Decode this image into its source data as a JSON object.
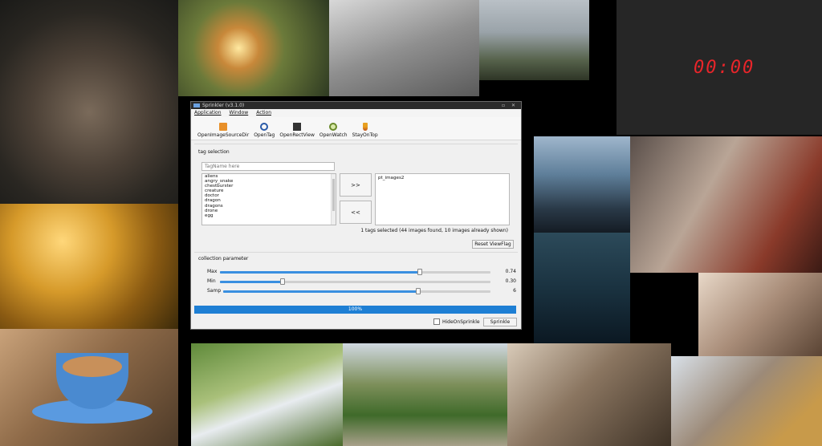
{
  "desktop": {
    "clock_text": "00:00"
  },
  "window": {
    "title": "Sprinkler (v3.1.0)",
    "menu": [
      "Application",
      "Window",
      "Action"
    ],
    "toolbar": [
      {
        "label": "OpenImageSourceDir",
        "icon": "folder-icon"
      },
      {
        "label": "OpenTag",
        "icon": "magnify-icon"
      },
      {
        "label": "OpenRectView",
        "icon": "monitor-icon"
      },
      {
        "label": "OpenWatch",
        "icon": "watch-icon"
      },
      {
        "label": "StayOnTop",
        "icon": "pin-icon"
      }
    ],
    "tag_selection": {
      "heading": "tag selection",
      "input_placeholder": "TagName here",
      "tags": [
        "aliens",
        "angry_snake",
        "chestburster",
        "creature",
        "doctor",
        "dragon",
        "dragons",
        "drone",
        "egg"
      ],
      "move_right_label": ">>",
      "move_left_label": "<<",
      "selected_tags": [
        "pt_images2"
      ],
      "status": "1 tags selected (44 images found, 10 images already shown)",
      "reset_label": "Reset ViewFlag"
    },
    "collection": {
      "heading": "collection parameter",
      "sliders": [
        {
          "label": "Max",
          "value": "0.74",
          "fraction": 0.74
        },
        {
          "label": "Min",
          "value": "0.30",
          "fraction": 0.23
        },
        {
          "label": "Samp",
          "value": "6",
          "fraction": 0.73
        }
      ]
    },
    "progress": {
      "text": "100%",
      "fraction": 1.0
    },
    "hide_checkbox_label": "HideOnSprinkle",
    "sprinkle_label": "Sprinkle"
  }
}
